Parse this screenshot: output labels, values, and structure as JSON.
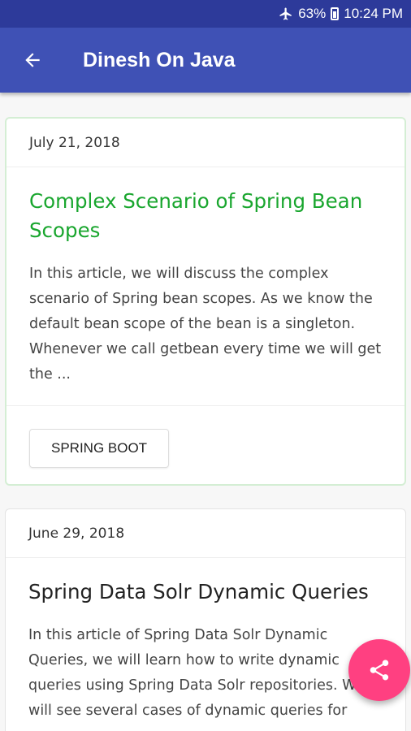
{
  "status_bar": {
    "battery": "63%",
    "time": "10:24 PM",
    "icons": [
      "airplane-icon",
      "battery-icon"
    ]
  },
  "app_bar": {
    "title": "Dinesh On Java",
    "back_icon": "arrow-back-icon",
    "color": "#3f51b5"
  },
  "posts": [
    {
      "date": "July 21, 2018",
      "title": "Complex Scenario of Spring Bean Scopes",
      "excerpt": "In this article, we will discuss the complex scenario of Spring bean scopes. As we know the default bean scope of the bean is a singleton. Whenever we call getbean every time we will get the ...",
      "tag": "SPRING BOOT",
      "title_color": "#19a62e"
    },
    {
      "date": "June 29, 2018",
      "title": "Spring Data Solr Dynamic Queries",
      "excerpt": "In this article of Spring Data Solr Dynamic Queries, we will learn how to write dynamic queries using Spring Data Solr repositories. We will see several cases of dynamic queries for"
    }
  ],
  "fab": {
    "icon": "share-icon",
    "color": "#ff4081"
  }
}
